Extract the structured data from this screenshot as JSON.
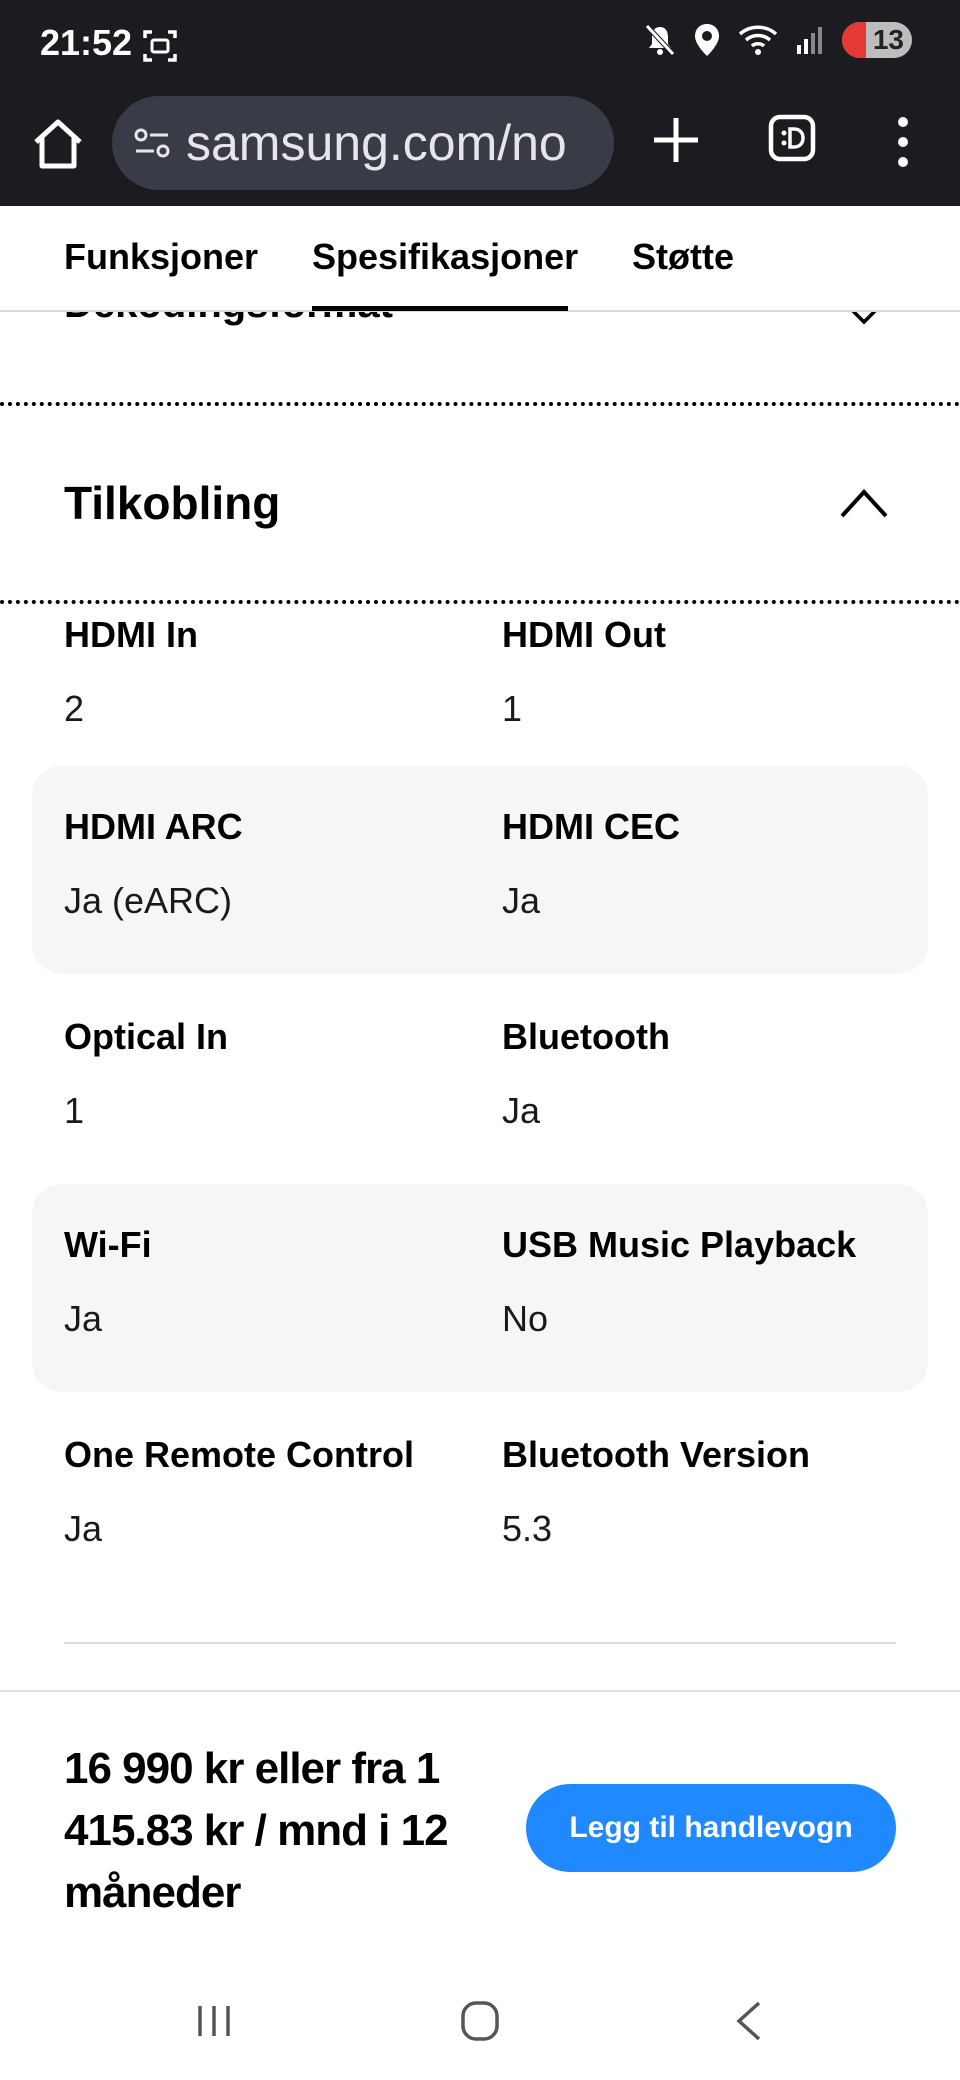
{
  "status_bar": {
    "time": "21:52",
    "battery_level": "13",
    "icons": [
      "screenshot-icon",
      "mute-icon",
      "location-icon",
      "wifi-icon",
      "signal-icon",
      "battery-icon"
    ]
  },
  "browser": {
    "url": "samsung.com/no",
    "icons": [
      "home-icon",
      "site-settings-icon",
      "new-tab-icon",
      "tab-switcher-icon",
      "more-menu-icon"
    ]
  },
  "page_nav": {
    "tabs": [
      {
        "label": "Funksjoner",
        "active": false
      },
      {
        "label": "Spesifikasjoner",
        "active": true
      },
      {
        "label": "Støtte",
        "active": false
      }
    ]
  },
  "previous_section": {
    "title": "Dekodingsformat"
  },
  "section": {
    "title": "Tilkobling",
    "expanded": true
  },
  "specs": [
    {
      "left": {
        "label": "HDMI In",
        "value": "2"
      },
      "right": {
        "label": "HDMI Out",
        "value": "1"
      }
    },
    {
      "left": {
        "label": "HDMI ARC",
        "value": "Ja (eARC)"
      },
      "right": {
        "label": "HDMI CEC",
        "value": "Ja"
      }
    },
    {
      "left": {
        "label": "Optical In",
        "value": "1"
      },
      "right": {
        "label": "Bluetooth",
        "value": "Ja"
      }
    },
    {
      "left": {
        "label": "Wi-Fi",
        "value": "Ja"
      },
      "right": {
        "label": "USB Music Playback",
        "value": "No"
      }
    },
    {
      "left": {
        "label": "One Remote Control",
        "value": "Ja"
      },
      "right": {
        "label": "Bluetooth Version",
        "value": "5.3"
      }
    }
  ],
  "buy_bar": {
    "price_text": "16 990 kr eller fra 1 415.83 kr / mnd i 12 måneder",
    "cart_button_label": "Legg til handlevogn",
    "cart_button_color": "#2189ff"
  },
  "system_nav": {
    "icons": [
      "recent-apps-icon",
      "home-circle-icon",
      "back-icon"
    ]
  }
}
